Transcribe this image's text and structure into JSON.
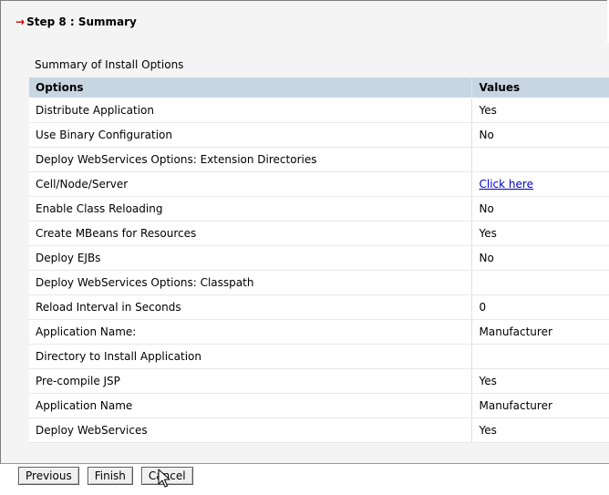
{
  "step": {
    "arrow": "→",
    "title": "Step 8 :  Summary"
  },
  "summary": {
    "caption": "Summary of Install Options",
    "headers": {
      "options": "Options",
      "values": "Values"
    },
    "rows": [
      {
        "option": "Distribute Application",
        "value": "Yes"
      },
      {
        "option": "Use Binary Configuration",
        "value": "No"
      },
      {
        "option": "Deploy WebServices Options: Extension Directories",
        "value": ""
      },
      {
        "option": "Cell/Node/Server",
        "value": "Click here"
      },
      {
        "option": "Enable Class Reloading",
        "value": "No"
      },
      {
        "option": "Create MBeans for Resources",
        "value": "Yes"
      },
      {
        "option": "Deploy EJBs",
        "value": "No"
      },
      {
        "option": "Deploy WebServices Options: Classpath",
        "value": ""
      },
      {
        "option": "Reload Interval in Seconds",
        "value": "0"
      },
      {
        "option": "Application Name:",
        "value": "Manufacturer"
      },
      {
        "option": "Directory to Install Application",
        "value": ""
      },
      {
        "option": "Pre-compile JSP",
        "value": "Yes"
      },
      {
        "option": "Application Name",
        "value": "Manufacturer"
      },
      {
        "option": "Deploy WebServices",
        "value": "Yes"
      }
    ]
  },
  "buttons": {
    "previous": "Previous",
    "finish": "Finish",
    "cancel": "Cancel"
  },
  "icons": {
    "step_arrow": "right-arrow-icon",
    "cursor": "mouse-pointer-icon"
  },
  "colors": {
    "header_bg": "#c8d6e2",
    "arrow": "#cc0000",
    "link": "#0000cc"
  }
}
